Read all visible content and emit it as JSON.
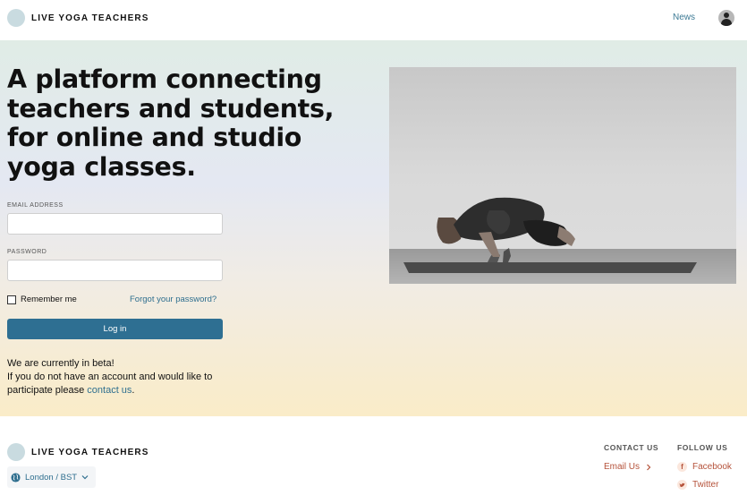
{
  "header": {
    "brand": "LIVE YOGA TEACHERS",
    "nav_news": "News"
  },
  "hero": {
    "headline": "A platform connecting teachers and students, for online and studio yoga classes.",
    "photo_icon": "yoga-pose-photo"
  },
  "login": {
    "email_label": "EMAIL ADDRESS",
    "email_value": "",
    "password_label": "PASSWORD",
    "password_value": "",
    "remember_label": "Remember me",
    "remember_checked": false,
    "forgot_label": "Forgot your password?",
    "login_button": "Log in"
  },
  "beta": {
    "line1": "We are currently in beta!",
    "line2_prefix": "If you do not have an account and would like to participate please ",
    "contact_link": "contact us",
    "line2_suffix": "."
  },
  "footer": {
    "brand": "LIVE YOGA TEACHERS",
    "timezone": "London / BST",
    "contact_heading": "CONTACT US",
    "email_link": "Email Us",
    "follow_heading": "FOLLOW US",
    "facebook": "Facebook",
    "twitter": "Twitter"
  },
  "colors": {
    "accent": "#2e6f92",
    "link": "#2f6f8f",
    "footer_link": "#b5523a"
  }
}
